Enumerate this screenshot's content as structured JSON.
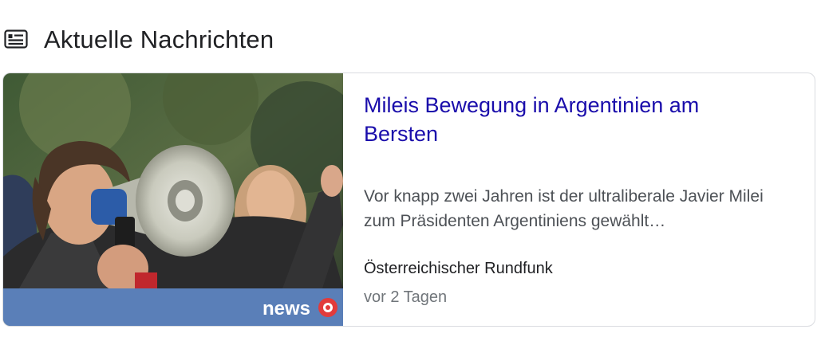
{
  "section": {
    "title": "Aktuelle Nachrichten",
    "icon": "newspaper-icon"
  },
  "card": {
    "headline": "Mileis Bewegung in Argentinien am Bersten",
    "snippet": "Vor knapp zwei Jahren ist der ultraliberale Javier Milei zum Präsidenten Argentiniens gewählt…",
    "source": "Österreichischer Rundfunk",
    "age": "vor 2 Tagen",
    "thumbnail": {
      "watermark": "news",
      "watermark_icon": "orf-logo-icon",
      "bar_color": "#5a7fb8"
    }
  },
  "colors": {
    "headline": "#1a0dab",
    "snippet": "#4d5156",
    "meta": "#70757a"
  }
}
